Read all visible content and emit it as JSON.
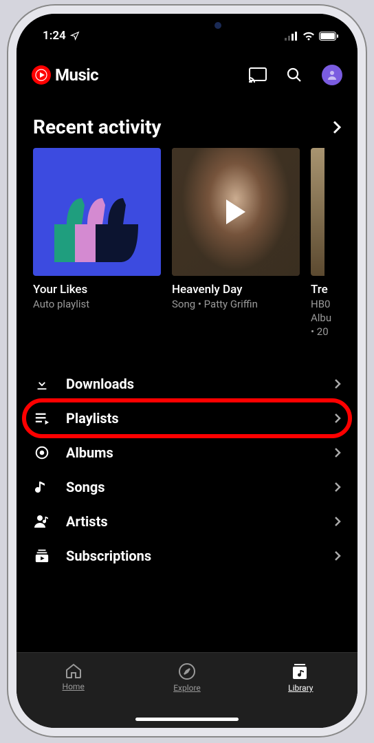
{
  "status": {
    "time": "1:24"
  },
  "header": {
    "appName": "Music"
  },
  "recent": {
    "title": "Recent activity",
    "cards": [
      {
        "title": "Your Likes",
        "subtitle": "Auto playlist"
      },
      {
        "title": "Heavenly Day",
        "subtitle": "Song • Patty Griffin"
      },
      {
        "title": "Tre",
        "subtitle": "HB0",
        "line3": "Albu",
        "line4": "• 20"
      }
    ]
  },
  "library": {
    "items": [
      {
        "label": "Downloads"
      },
      {
        "label": "Playlists"
      },
      {
        "label": "Albums"
      },
      {
        "label": "Songs"
      },
      {
        "label": "Artists"
      },
      {
        "label": "Subscriptions"
      }
    ]
  },
  "tabs": {
    "home": "Home",
    "explore": "Explore",
    "library": "Library"
  }
}
